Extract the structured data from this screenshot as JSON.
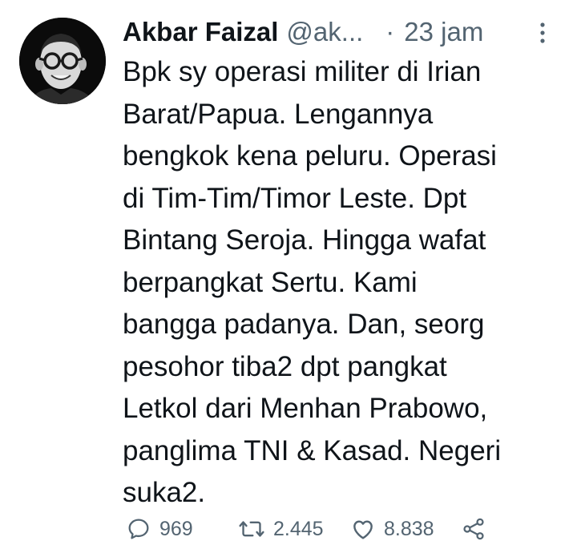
{
  "tweet": {
    "author_name": "Akbar Faizal",
    "author_handle": "@ak...",
    "separator": "·",
    "time": "23 jam",
    "text": "Bpk sy operasi militer di Irian\nBarat/Papua. Lengannya\nbengkok kena peluru. Operasi\ndi Tim-Tim/Timor Leste. Dpt\nBintang Seroja. Hingga wafat\nberpangkat Sertu. Kami\nbangga padanya. Dan, seorg\npesohor tiba2 dpt pangkat\nLetkol dari Menhan Prabowo,\npanglima TNI & Kasad. Negeri\nsuka2."
  },
  "actions": {
    "replies": "969",
    "retweets": "2.445",
    "likes": "8.838"
  },
  "icons": {
    "reply": "reply-icon",
    "retweet": "retweet-icon",
    "like": "heart-icon",
    "share": "share-icon",
    "more": "more-vertical-icon"
  },
  "colors": {
    "text_primary": "#0f1419",
    "text_secondary": "#536471"
  }
}
